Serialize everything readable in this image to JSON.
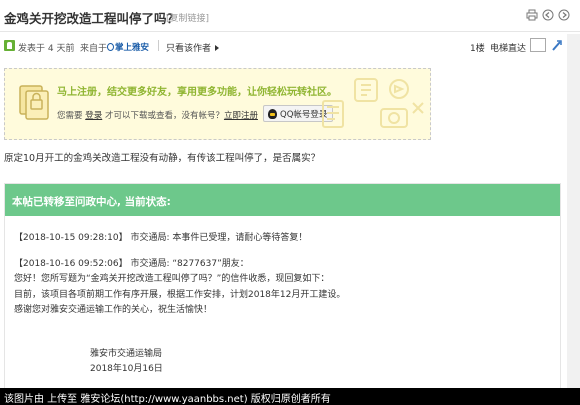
{
  "post": {
    "title": "金鸡关开挖改造工程叫停了吗？",
    "copy_link": "[复制链接]",
    "posted": "发表于 4 天前",
    "from_label": "来自于",
    "app_name": "掌上雅安",
    "only_author": "只看该作者",
    "floor": "1楼",
    "goto_label": "电梯直达"
  },
  "promo": {
    "headline": "马上注册，结交更多好友，享用更多功能，让你轻松玩转社区。",
    "sub_prefix": "您需要",
    "login_link": "登录",
    "sub_middle": "才可以下载或查看，没有帐号？",
    "register_link": "立即注册",
    "qq_button": "QQ帐号登录"
  },
  "body_text": "原定10月开工的金鸡关改造工程没有动静，有传该工程叫停了，是否属实？",
  "status": {
    "header": "本帖已转移至问政中心, 当前状态:",
    "lines": [
      "【2018-10-15 09:28:10】 市交通局:   本事件已受理，请耐心等待答复！",
      "【2018-10-16 09:52:06】 市交通局:   “8277637”朋友：",
      "您好！您所写题为“金鸡关开挖改造工程叫停了吗？”的信件收悉，现回复如下：",
      "目前，该项目各项前期工作有序开展，根据工作安排，计划2018年12月开工建设。",
      "感谢您对雅安交通运输工作的关心，祝生活愉快！"
    ],
    "sign_org": "雅安市交通运输局",
    "sign_date": "2018年10月16日"
  },
  "footer": "该图片由  上传至 雅安论坛(http://www.yaanbbs.net) 版权归原创者所有",
  "colors": {
    "status_green": "#6dc88b",
    "promo_bg": "#fffbdc",
    "promo_headline": "#8fb531"
  }
}
